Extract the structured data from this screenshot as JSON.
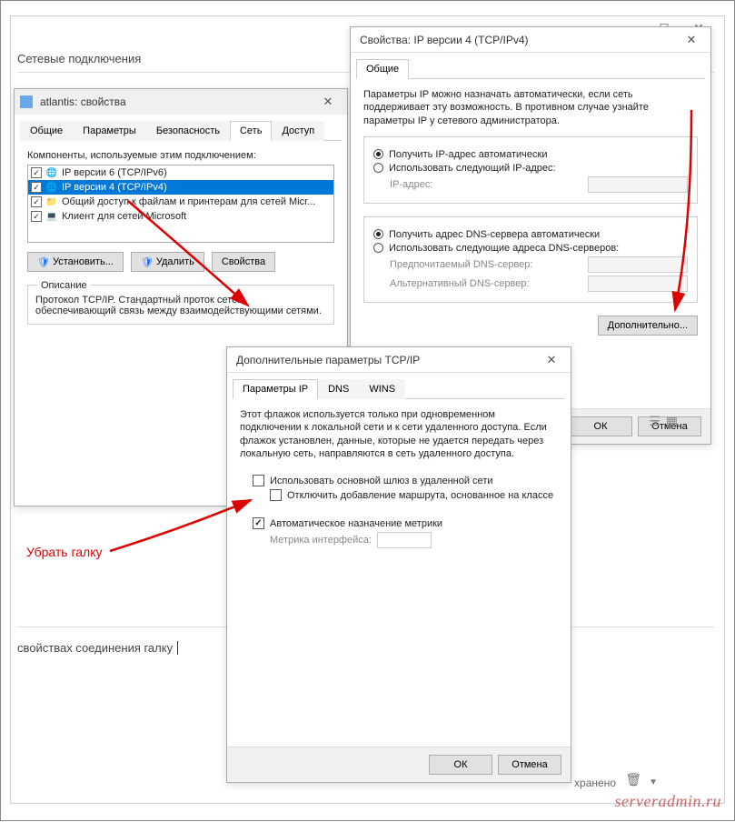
{
  "background": {
    "header": "Сетевые подключения",
    "bottom_text": "свойствах соединения галку"
  },
  "annotation": {
    "remove_check": "Убрать галку"
  },
  "props_win": {
    "title": "atlantis: свойства",
    "tabs": [
      "Общие",
      "Параметры",
      "Безопасность",
      "Сеть",
      "Доступ"
    ],
    "active_tab": 3,
    "components_label": "Компоненты, используемые этим подключением:",
    "items": [
      {
        "label": "IP версии 6 (TCP/IPv6)"
      },
      {
        "label": "IP версии 4 (TCP/IPv4)"
      },
      {
        "label": "Общий доступ к файлам и принтерам для сетей Micr..."
      },
      {
        "label": "Клиент для сетей Microsoft"
      }
    ],
    "install_btn": "Установить...",
    "remove_btn": "Удалить",
    "props_btn": "Свойства",
    "desc_legend": "Описание",
    "desc_text": "Протокол TCP/IP. Стандартный проток сетей, обеспечивающий связь между взаимодействующими сетями."
  },
  "ipv4_win": {
    "title": "Свойства: IP версии 4 (TCP/IPv4)",
    "tab": "Общие",
    "intro": "Параметры IP можно назначать автоматически, если сеть поддерживает эту возможность. В противном случае узнайте параметры IP у сетевого администратора.",
    "auto_ip": "Получить IP-адрес автоматически",
    "manual_ip": "Использовать следующий IP-адрес:",
    "ip_label": "IP-адрес:",
    "auto_dns": "Получить адрес DNS-сервера автоматически",
    "manual_dns": "Использовать следующие адреса DNS-серверов:",
    "pref_dns": "Предпочитаемый DNS-сервер:",
    "alt_dns": "Альтернативный DNS-сервер:",
    "advanced_btn": "Дополнительно...",
    "ok_btn": "ОК",
    "cancel_btn": "Отмена"
  },
  "adv_win": {
    "title": "Дополнительные параметры TCP/IP",
    "tabs": [
      "Параметры IP",
      "DNS",
      "WINS"
    ],
    "active_tab": 0,
    "intro": "Этот флажок используется только при одновременном подключении к локальной сети и к сети удаленного доступа. Если флажок установлен, данные, которые не удается передать через локальную сеть, направляются в сеть удаленного доступа.",
    "use_gateway": "Использовать основной шлюз в удаленной сети",
    "disable_route": "Отключить добавление маршрута, основанное на классе",
    "auto_metric": "Автоматическое назначение метрики",
    "metric_label": "Метрика интерфейса:",
    "ok_btn": "ОК",
    "cancel_btn": "Отмена"
  },
  "bottom_status": "хранено",
  "watermark": "serveradmin.ru"
}
